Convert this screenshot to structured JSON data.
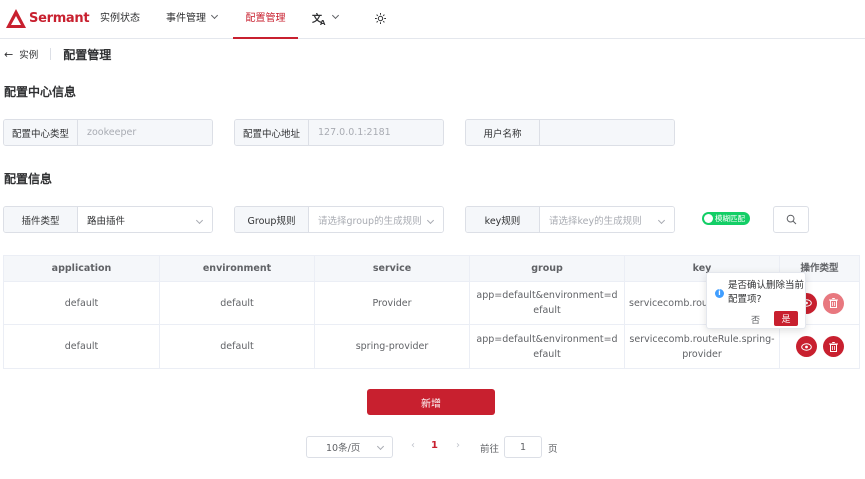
{
  "brand": {
    "name": "Sermant",
    "color": "#c8202f"
  },
  "nav": {
    "instance_status": "实例状态",
    "event_management": "事件管理",
    "config_management": "配置管理",
    "language_icon": "translate-icon",
    "theme_icon": "sun-icon"
  },
  "breadcrumb": {
    "back": "实例",
    "title": "配置管理"
  },
  "config_center": {
    "section_title": "配置中心信息",
    "type_label": "配置中心类型",
    "type_value": "zookeeper",
    "address_label": "配置中心地址",
    "address_value": "127.0.0.1:2181",
    "username_label": "用户名称",
    "username_value": ""
  },
  "config_info": {
    "section_title": "配置信息",
    "plugin_label": "插件类型",
    "plugin_value": "路由插件",
    "group_label": "Group规则",
    "group_placeholder": "请选择group的生成规则",
    "key_label": "key规则",
    "key_placeholder": "请选择key的生成规则",
    "fuzzy_switch_label": "模糊匹配",
    "fuzzy_switch_on": true,
    "search_icon": "search-icon"
  },
  "table": {
    "headers": [
      "application",
      "environment",
      "service",
      "group",
      "key",
      "操作类型"
    ],
    "rows": [
      {
        "application": "default",
        "environment": "default",
        "service": "Provider",
        "group": "app=default&environment=default",
        "key": "servicecomb.rout"
      },
      {
        "application": "default",
        "environment": "default",
        "service": "spring-provider",
        "group": "app=default&environment=default",
        "key": "servicecomb.routeRule.spring-provider"
      }
    ]
  },
  "popconfirm": {
    "message": "是否确认删除当前配置项?",
    "cancel": "否",
    "confirm": "是",
    "icon": "info-icon"
  },
  "add_button": "新增",
  "pagination": {
    "page_size": "10条/页",
    "current_page": "1",
    "goto_label": "前往",
    "goto_value": "1",
    "page_suffix": "页",
    "prev": "‹",
    "next": "›"
  }
}
